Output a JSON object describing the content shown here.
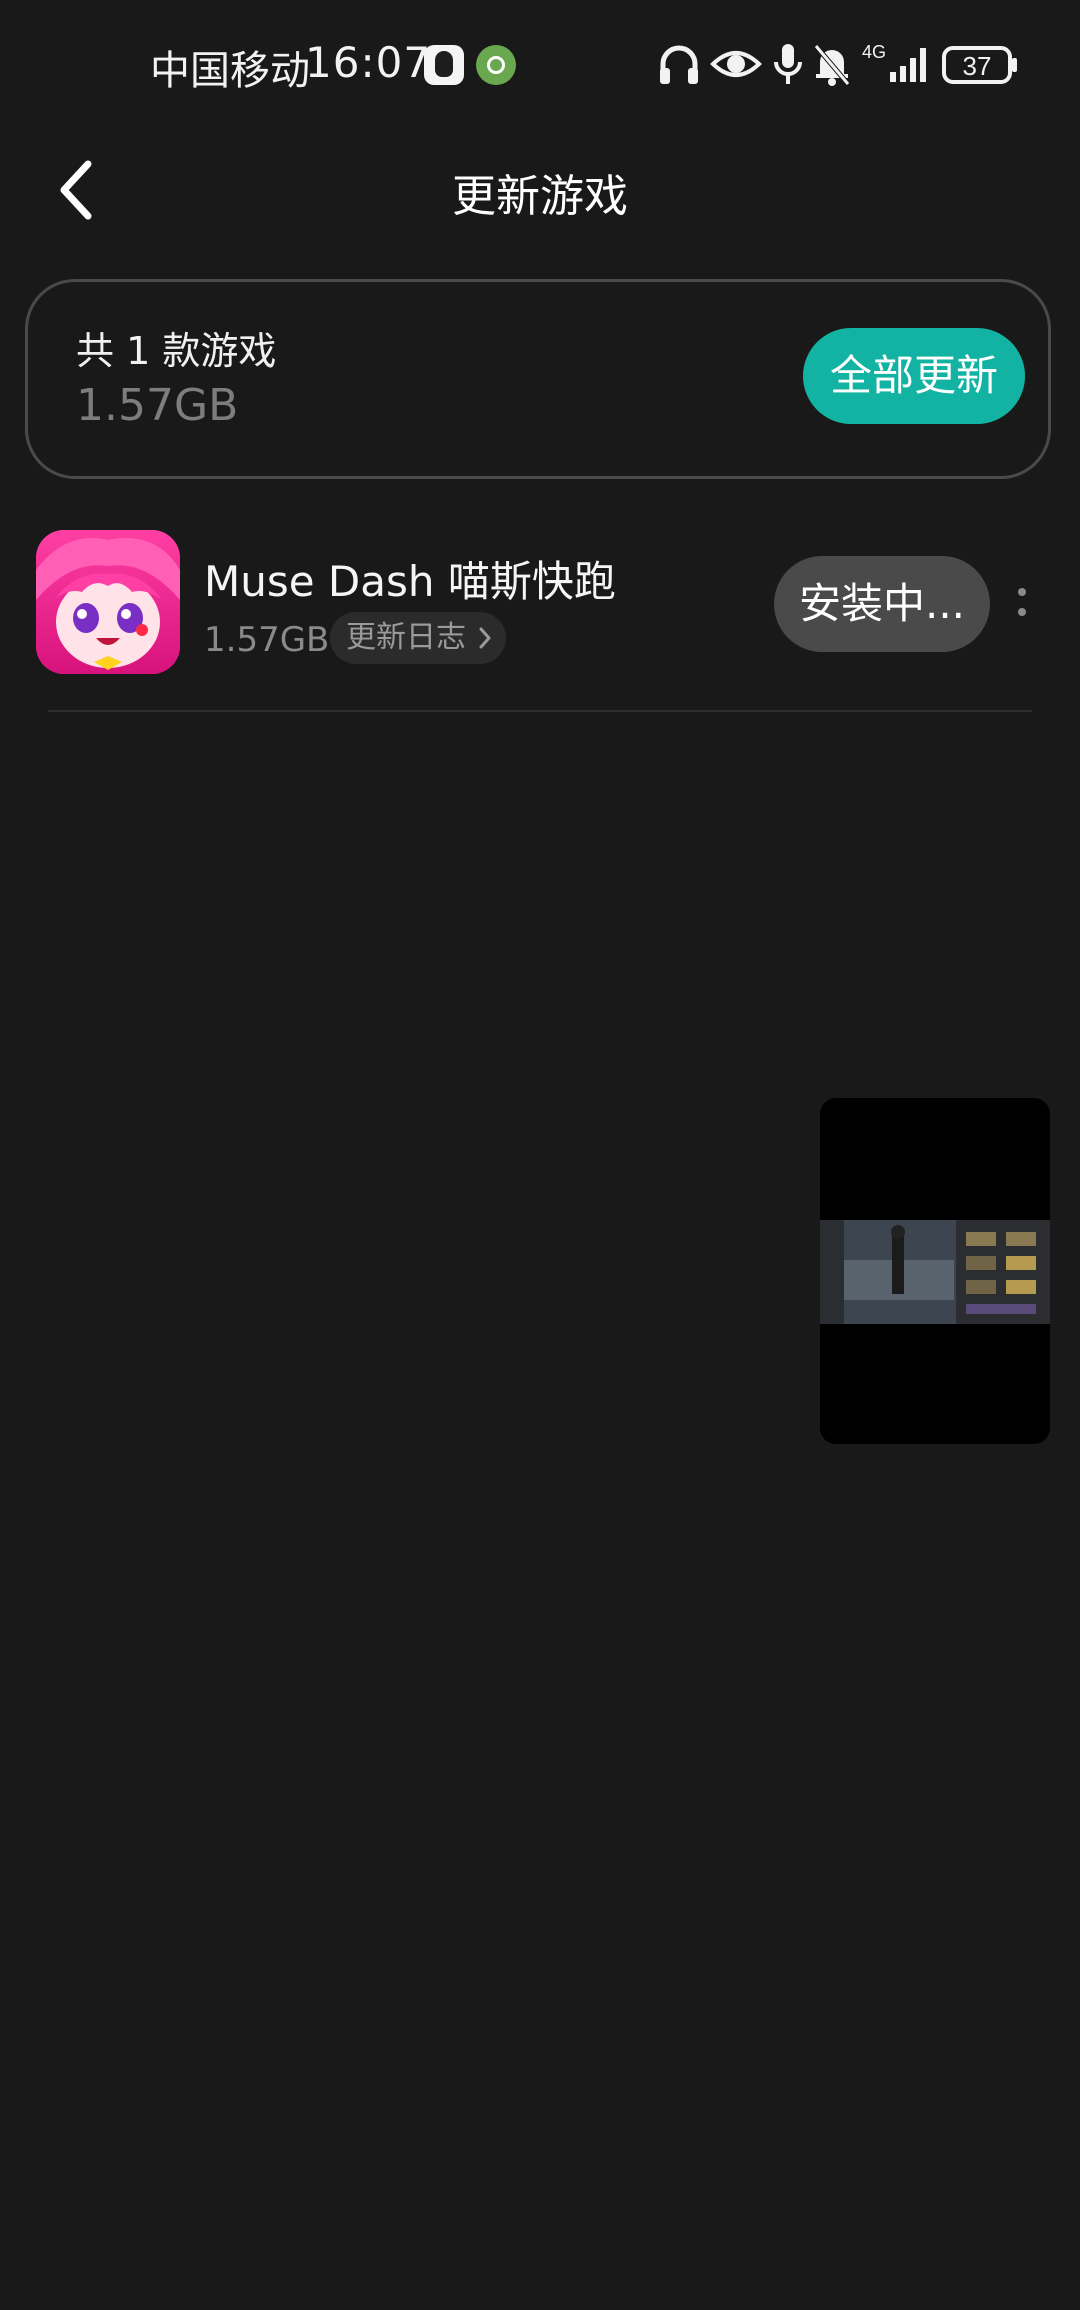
{
  "status_bar": {
    "carrier": "中国移动",
    "time": "16:07",
    "network": "4G",
    "battery": "37"
  },
  "header": {
    "title": "更新游戏"
  },
  "summary": {
    "count_text": "共 1 款游戏",
    "total_size": "1.57GB",
    "update_all_label": "全部更新",
    "accent_color": "#12b3a2"
  },
  "games": [
    {
      "name": "Muse Dash 喵斯快跑",
      "size": "1.57GB",
      "changelog_label": "更新日志",
      "action_label": "安装中..."
    }
  ],
  "icons": {
    "back": "back-arrow-icon",
    "more": "more-vertical-icon",
    "changelog_chevron": "chevron-right-icon",
    "headphones": "headphones-icon",
    "eye": "eye-icon",
    "mic": "microphone-icon",
    "bell_muted": "bell-off-icon",
    "signal": "signal-icon",
    "battery": "battery-icon"
  }
}
